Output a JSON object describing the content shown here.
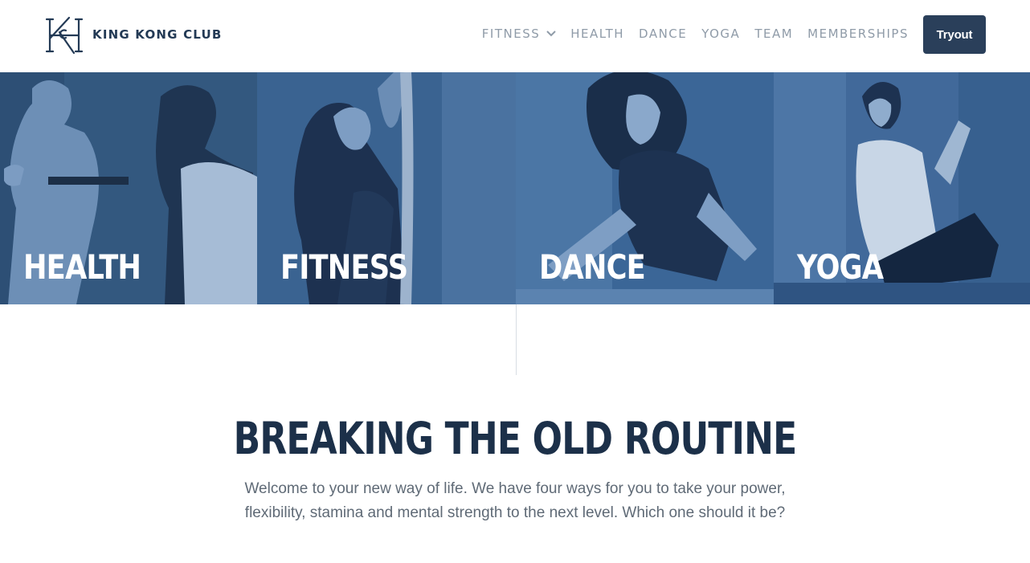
{
  "header": {
    "brand": "KING KONG CLUB",
    "logo_icon": "kkc-monogram-icon",
    "nav": [
      {
        "label": "FITNESS",
        "has_dropdown": true
      },
      {
        "label": "HEALTH"
      },
      {
        "label": "DANCE"
      },
      {
        "label": "YOGA"
      },
      {
        "label": "TEAM"
      },
      {
        "label": "MEMBERSHIPS"
      }
    ],
    "cta_label": "Tryout"
  },
  "tiles": [
    {
      "label": "HEALTH"
    },
    {
      "label": "FITNESS"
    },
    {
      "label": "DANCE"
    },
    {
      "label": "YOGA"
    }
  ],
  "main": {
    "heading": "BREAKING THE OLD ROUTINE",
    "intro": "Welcome to your new way of life. We have four ways for you to take your power, flexibility, stamina and mental strength to the next level. Which one should it be?"
  },
  "colors": {
    "brand_navy": "#1c3049",
    "button_bg": "#2a3f5a",
    "nav_text": "#8f9ba8",
    "tile_overlay": "#3a6596"
  }
}
